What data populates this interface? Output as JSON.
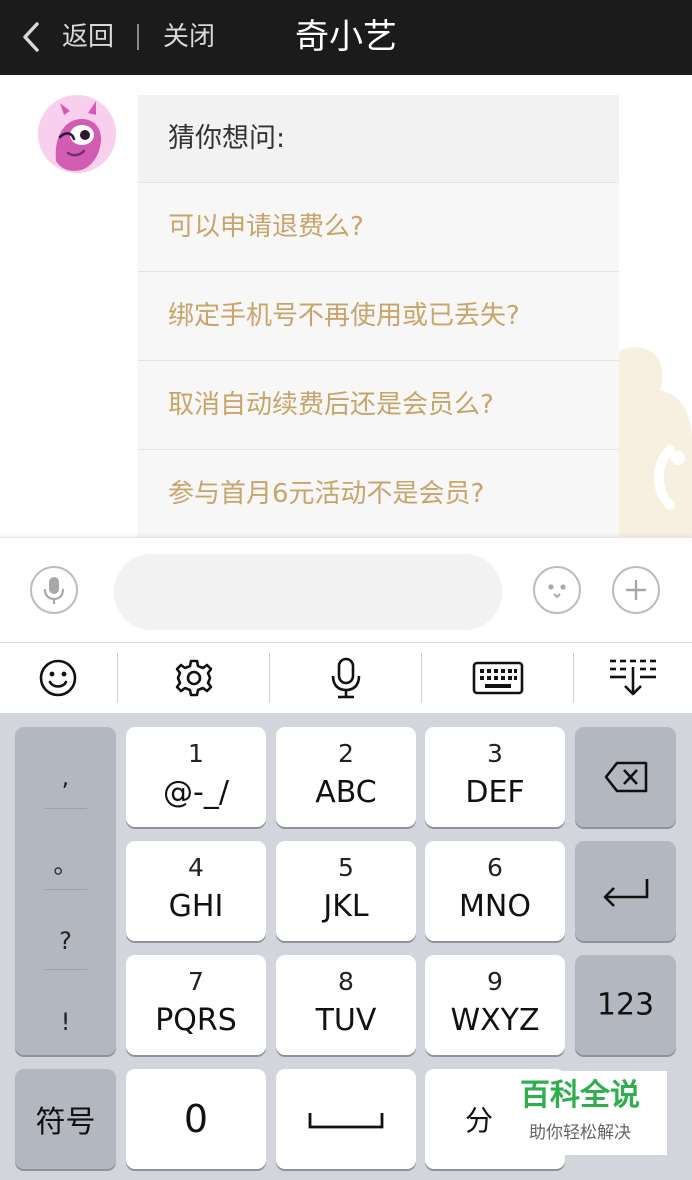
{
  "header": {
    "back_label": "返回",
    "close_label": "关闭",
    "title": "奇小艺"
  },
  "chat": {
    "bubble_heading": "猜你想问:",
    "questions": [
      "可以申请退费么?",
      "绑定手机号不再使用或已丢失?",
      "取消自动续费后还是会员么?",
      "参与首月6元活动不是会员?"
    ]
  },
  "input": {
    "placeholder": ""
  },
  "keyboard": {
    "punctuation": [
      ",",
      "。",
      "?",
      "!"
    ],
    "keys": [
      {
        "num": "1",
        "letters": "@-_/"
      },
      {
        "num": "2",
        "letters": "ABC"
      },
      {
        "num": "3",
        "letters": "DEF"
      },
      {
        "num": "4",
        "letters": "GHI"
      },
      {
        "num": "5",
        "letters": "JKL"
      },
      {
        "num": "6",
        "letters": "MNO"
      },
      {
        "num": "7",
        "letters": "PQRS"
      },
      {
        "num": "8",
        "letters": "TUV"
      },
      {
        "num": "9",
        "letters": "WXYZ"
      }
    ],
    "numbers_label": "123",
    "symbols_label": "符号",
    "zero_label": "0",
    "segment_label": "分"
  },
  "watermark": {
    "title": "百科全说",
    "subtitle": "助你轻松解决"
  },
  "colors": {
    "header_bg": "#1b1b1b",
    "question_text": "#c9a46a",
    "keyboard_bg": "#d2d5db",
    "watermark_green": "#2fae4e"
  }
}
